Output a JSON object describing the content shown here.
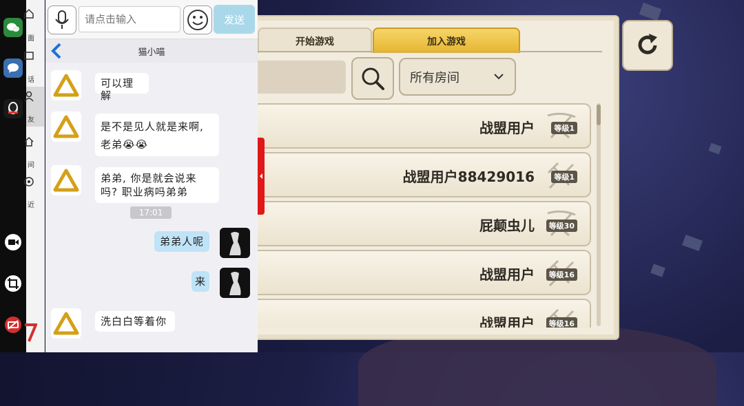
{
  "chat": {
    "input_placeholder": "请点击输入",
    "send_label": "发送",
    "title": "猫小喵",
    "timestamp": "17:01",
    "messages": [
      {
        "side": "left",
        "text": "可以理解"
      },
      {
        "side": "left",
        "text": "是不是见人就是来啊, 老弟😭😭"
      },
      {
        "side": "left",
        "text": "弟弟, 你是就会说来吗? 职业病吗弟弟"
      },
      {
        "side": "right",
        "text": "弟弟人呢"
      },
      {
        "side": "right",
        "text": "来"
      },
      {
        "side": "left",
        "text": "洗白白等着你"
      }
    ]
  },
  "nav": {
    "items": [
      {
        "label": "面"
      },
      {
        "label": "话"
      },
      {
        "label": "友"
      },
      {
        "label": "间"
      },
      {
        "label": "近"
      }
    ]
  },
  "game": {
    "tabs": [
      {
        "label": "开始游戏",
        "active": false
      },
      {
        "label": "加入游戏",
        "active": true
      }
    ],
    "room_filter": "所有房间",
    "rooms": [
      {
        "name": "战盟用户",
        "level": "等级1"
      },
      {
        "name": "战盟用户88429016",
        "level": "等级1"
      },
      {
        "name": "屁颠虫儿",
        "level": "等级30"
      },
      {
        "name": "战盟用户",
        "level": "等级16"
      },
      {
        "name": "战盟用户",
        "level": "等级16"
      }
    ]
  },
  "colors": {
    "tab_active": "#e6b52e",
    "send_button": "#a9d8ea",
    "self_bubble": "#bfe3f7",
    "red_handle": "#e01818"
  }
}
